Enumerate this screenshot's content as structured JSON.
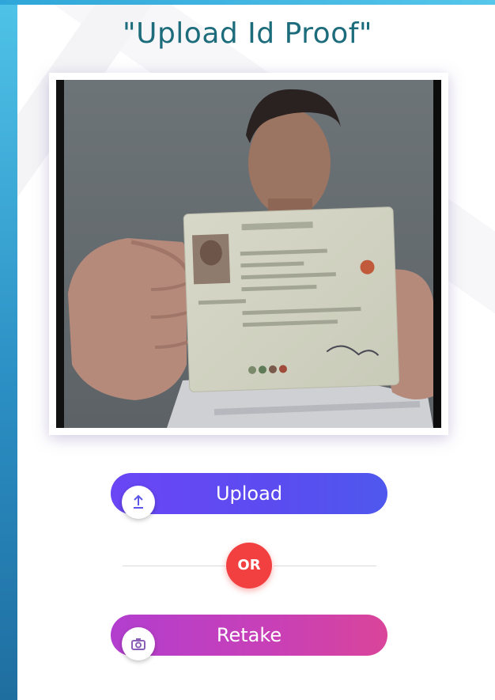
{
  "page": {
    "title": "\"Upload Id Proof\""
  },
  "preview": {
    "icon": "captured-id-photo"
  },
  "actions": {
    "upload_label": "Upload",
    "upload_icon": "upload-arrow-icon",
    "or_label": "OR",
    "retake_label": "Retake",
    "retake_icon": "camera-icon"
  },
  "colors": {
    "title": "#1d6c7c",
    "upload_gradient": [
      "#6a46f5",
      "#4e58ee"
    ],
    "retake_gradient": [
      "#b23ecf",
      "#d9459a"
    ],
    "or_badge": "#f23f3f",
    "side_strip": "#2b8fc4"
  }
}
